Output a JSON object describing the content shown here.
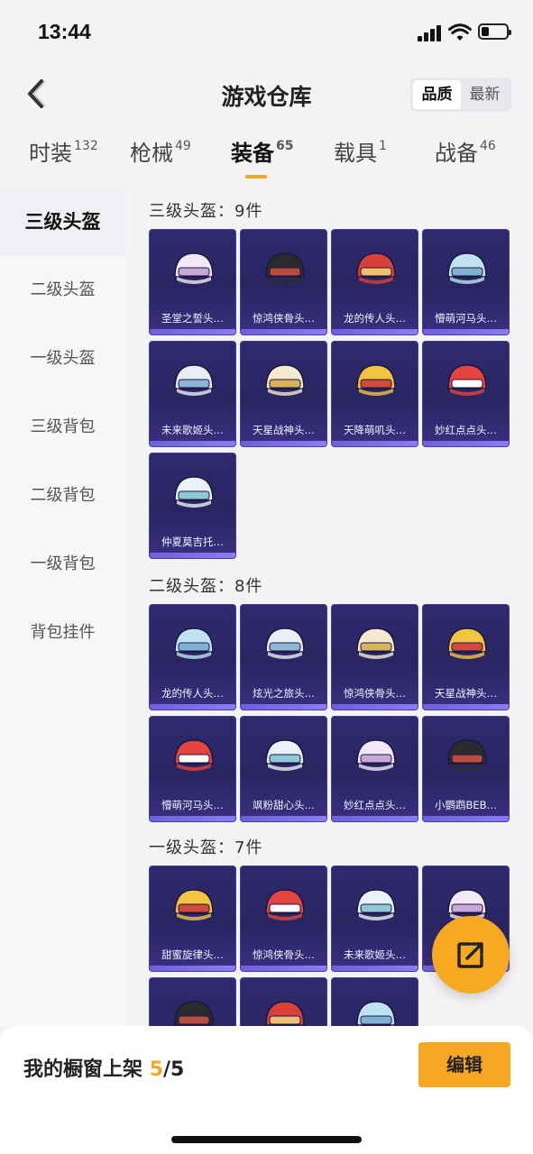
{
  "status": {
    "time": "13:44"
  },
  "header": {
    "title": "游戏仓库",
    "sort_options": [
      "品质",
      "最新"
    ],
    "sort_selected": "品质"
  },
  "tabs": [
    {
      "label": "时装",
      "count": "132"
    },
    {
      "label": "枪械",
      "count": "49"
    },
    {
      "label": "装备",
      "count": "65"
    },
    {
      "label": "载具",
      "count": "1"
    },
    {
      "label": "战备",
      "count": "46"
    }
  ],
  "active_tab": "装备",
  "sidebar": {
    "items": [
      "三级头盔",
      "二级头盔",
      "一级头盔",
      "三级背包",
      "二级背包",
      "一级背包",
      "背包挂件"
    ]
  },
  "sections": [
    {
      "title": "三级头盔：9件",
      "items": [
        "圣堂之誓头…",
        "惊鸿侠骨头…",
        "龙的传人头…",
        "懵萌河马头…",
        "未来歌姬头…",
        "天星战神头…",
        "天降萌叽头…",
        "妙红点点头…",
        "仲夏莫吉托…"
      ]
    },
    {
      "title": "二级头盔：8件",
      "items": [
        "龙的传人头…",
        "炫光之旅头…",
        "惊鸿侠骨头…",
        "天星战神头…",
        "懵萌河马头…",
        "飒粉甜心头…",
        "妙红点点头…",
        "小鹦鹉BEB…"
      ]
    },
    {
      "title": "一级头盔：7件",
      "items": [
        "甜蜜旋律头…",
        "惊鸿侠骨头…",
        "未来歌姬头…",
        "",
        "",
        "",
        ""
      ]
    }
  ],
  "bottom": {
    "shelf_label": "我的橱窗上架",
    "shelf_count": "5",
    "shelf_total": "/5",
    "edit_label": "编辑"
  },
  "colors": {
    "accent": "#f5a623",
    "card_bg": "#2a2562"
  },
  "icons": [
    "back-arrow-icon",
    "share-icon",
    "helmet-icon"
  ]
}
